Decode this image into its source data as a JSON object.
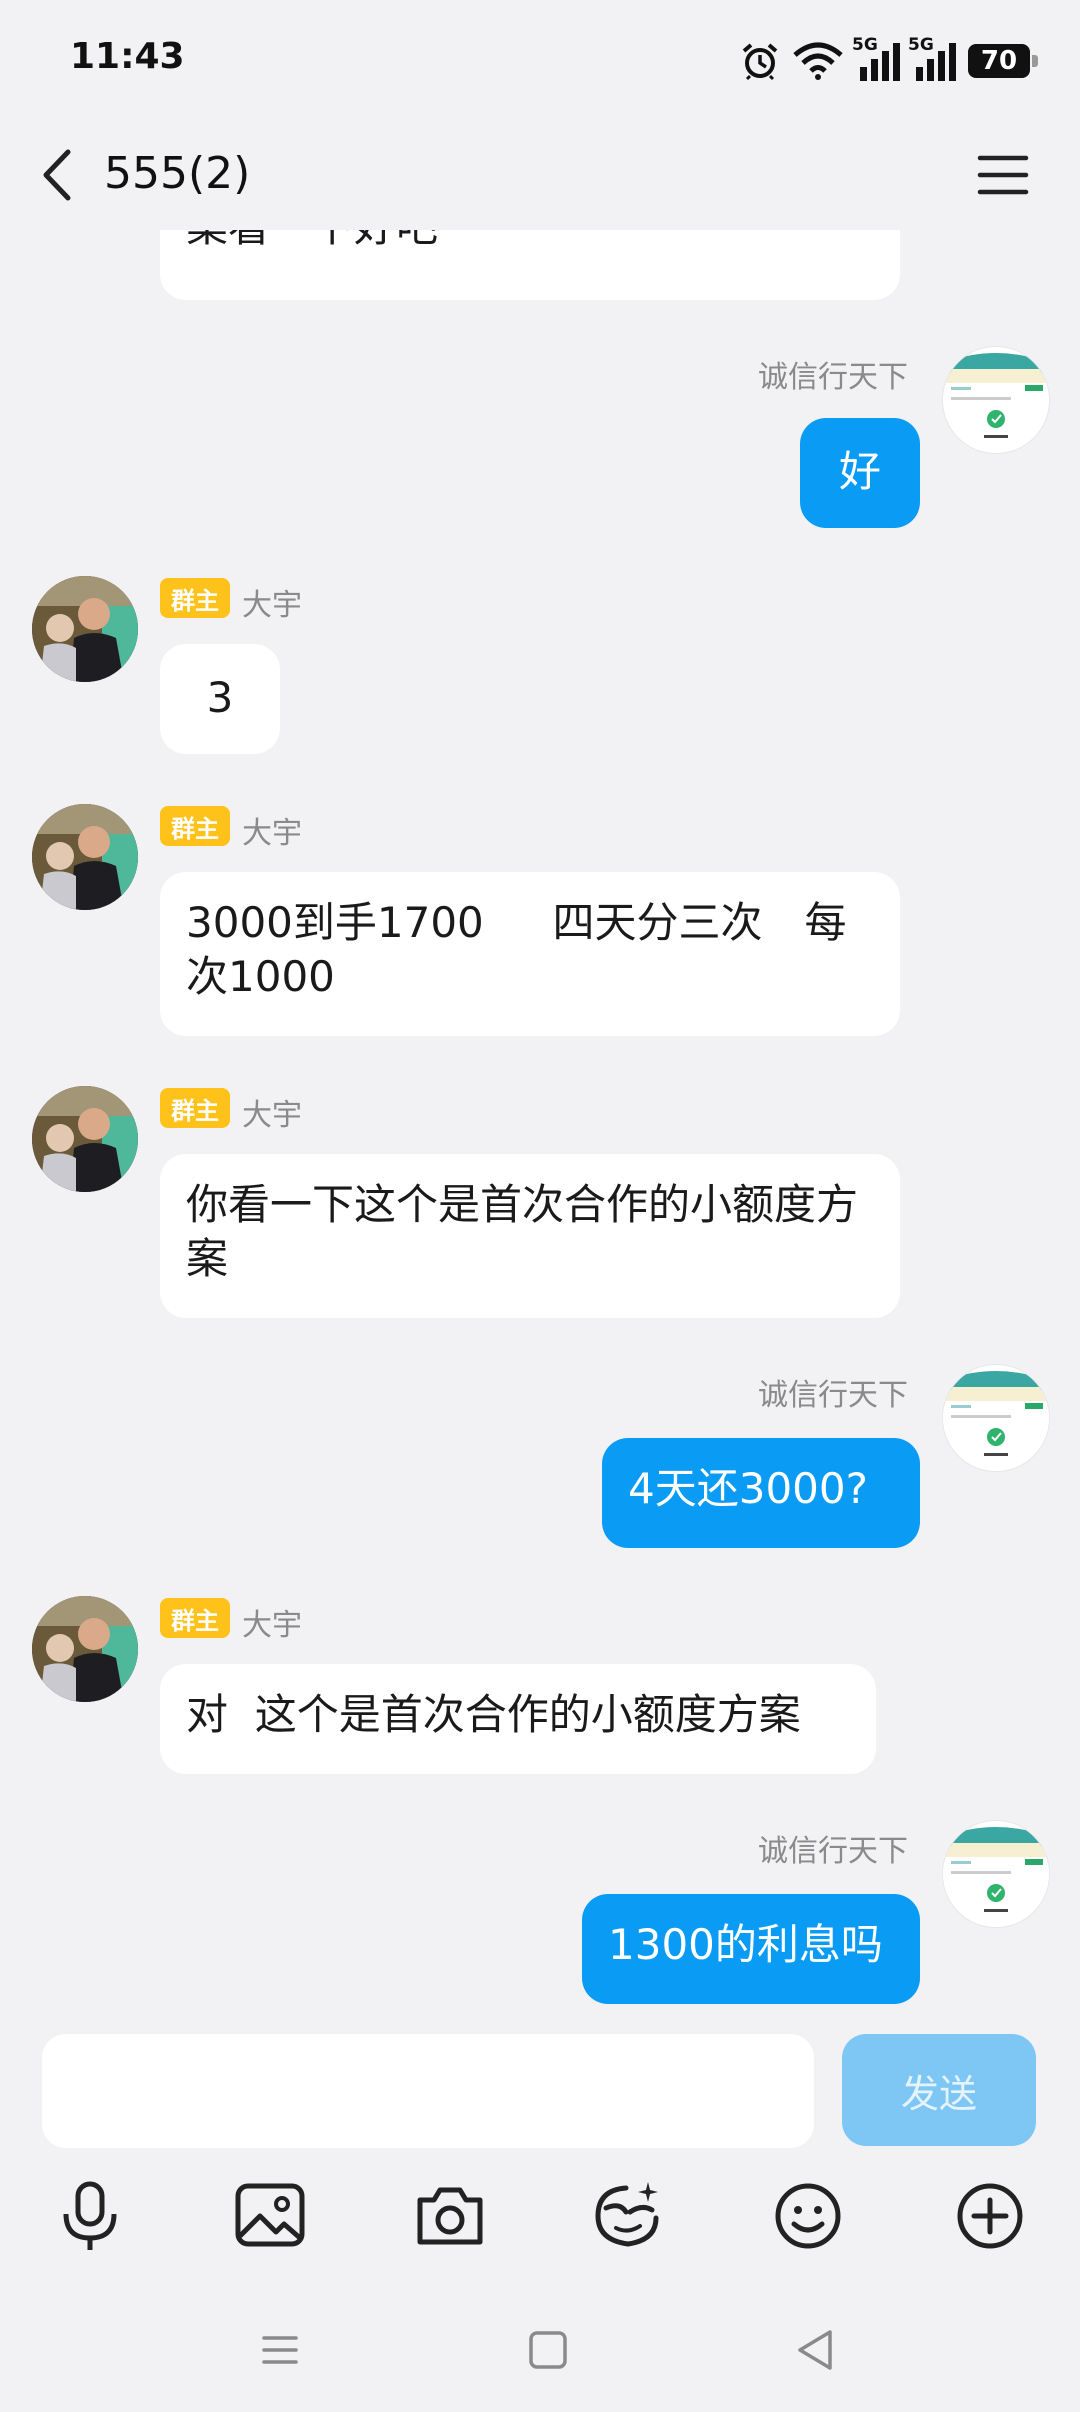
{
  "status_bar": {
    "time": "11:43",
    "battery": "70",
    "signal_1_label": "5G",
    "signal_2_label": "5G"
  },
  "header": {
    "title": "555(2)"
  },
  "messages": [
    {
      "type": "in",
      "text": "桑看一下好吧"
    },
    {
      "type": "out",
      "sender": "诚信行天下",
      "text": "好"
    },
    {
      "type": "in",
      "role": "群主",
      "sender": "大宇",
      "text": "3"
    },
    {
      "type": "in",
      "role": "群主",
      "sender": "大宇",
      "text": "3000到手1700　  四天分三次　每次1000"
    },
    {
      "type": "in",
      "role": "群主",
      "sender": "大宇",
      "text": "你看一下这个是首次合作的小额度方案"
    },
    {
      "type": "out",
      "sender": "诚信行天下",
      "text": "4天还3000?"
    },
    {
      "type": "in",
      "role": "群主",
      "sender": "大宇",
      "text": "对  这个是首次合作的小额度方案"
    },
    {
      "type": "out",
      "sender": "诚信行天下",
      "text": "1300的利息吗"
    }
  ],
  "input": {
    "placeholder": "",
    "send_label": "发送"
  },
  "toolbar": [
    "microphone-icon",
    "image-icon",
    "camera-icon",
    "sticker-icon",
    "emoji-icon",
    "plus-icon"
  ],
  "nav": [
    "menu-nav-icon",
    "home-nav-icon",
    "back-nav-icon"
  ],
  "colors": {
    "outgoing_bubble": "#0a9bf5",
    "incoming_bubble": "#ffffff",
    "role_tag": "#ffc21a",
    "send_button": "#7ec7f5",
    "background": "#f2f2f4"
  }
}
